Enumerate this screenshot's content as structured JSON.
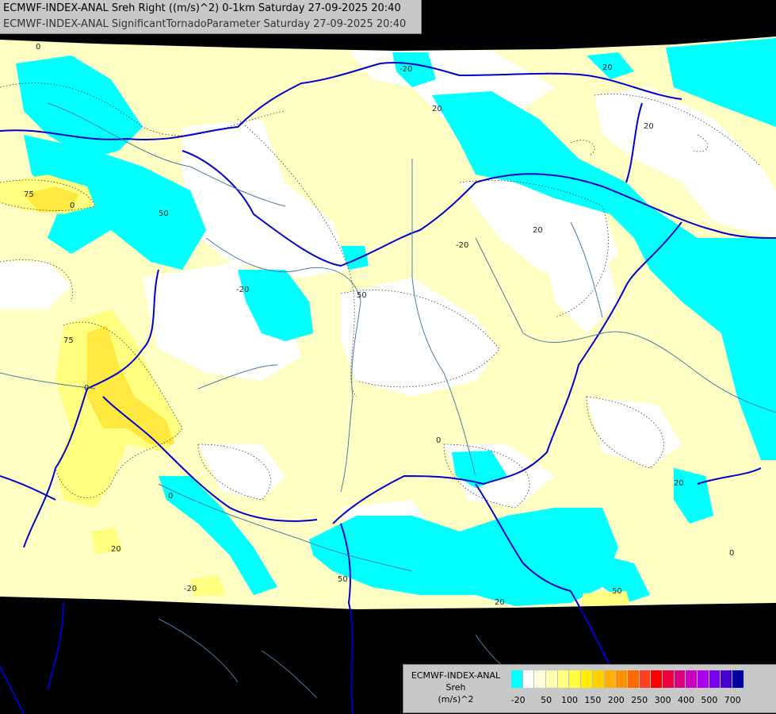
{
  "header": {
    "line1": "ECMWF-INDEX-ANAL Sreh Right ((m/s)^2) 0-1km Saturday 27-09-2025 20:40",
    "line2": "ECMWF-INDEX-ANAL SignificantTornadoParameter Saturday 27-09-2025 20:40"
  },
  "legend": {
    "source": "ECMWF-INDEX-ANAL",
    "variable": "Sreh",
    "unit": "(m/s)^2",
    "colors": [
      "#00ffff",
      "#ffffff",
      "#ffffe0",
      "#ffffb0",
      "#ffff80",
      "#ffff40",
      "#ffee00",
      "#ffd000",
      "#ffb000",
      "#ff9000",
      "#ff6a00",
      "#ff4020",
      "#ff0000",
      "#ee0040",
      "#dd0080",
      "#cc00bb",
      "#aa00ee",
      "#7700ee",
      "#4400cc",
      "#0000a0"
    ],
    "ticks": [
      "-20",
      "50",
      "100",
      "150",
      "200",
      "250",
      "300",
      "400",
      "500",
      "700"
    ]
  },
  "contour_labels": [
    "0",
    "-20",
    "20",
    "50",
    "75",
    "0",
    "20",
    "20",
    "-20",
    "50",
    "75",
    "0",
    "-20",
    "20",
    "0",
    "0",
    "20",
    "-20",
    "50",
    "20",
    "0",
    "50",
    "20",
    "20",
    "-20",
    "0",
    "0"
  ],
  "map": {
    "background_color": "#000000",
    "domain_color": "#ffffc4",
    "shear_negative_color": "#00ffff",
    "neutral_color": "#ffffff",
    "moderate_color": "#ffff80",
    "strong_color": "#ffe840",
    "border_color": "#0000cc",
    "river_color": "#4a7aa8"
  }
}
